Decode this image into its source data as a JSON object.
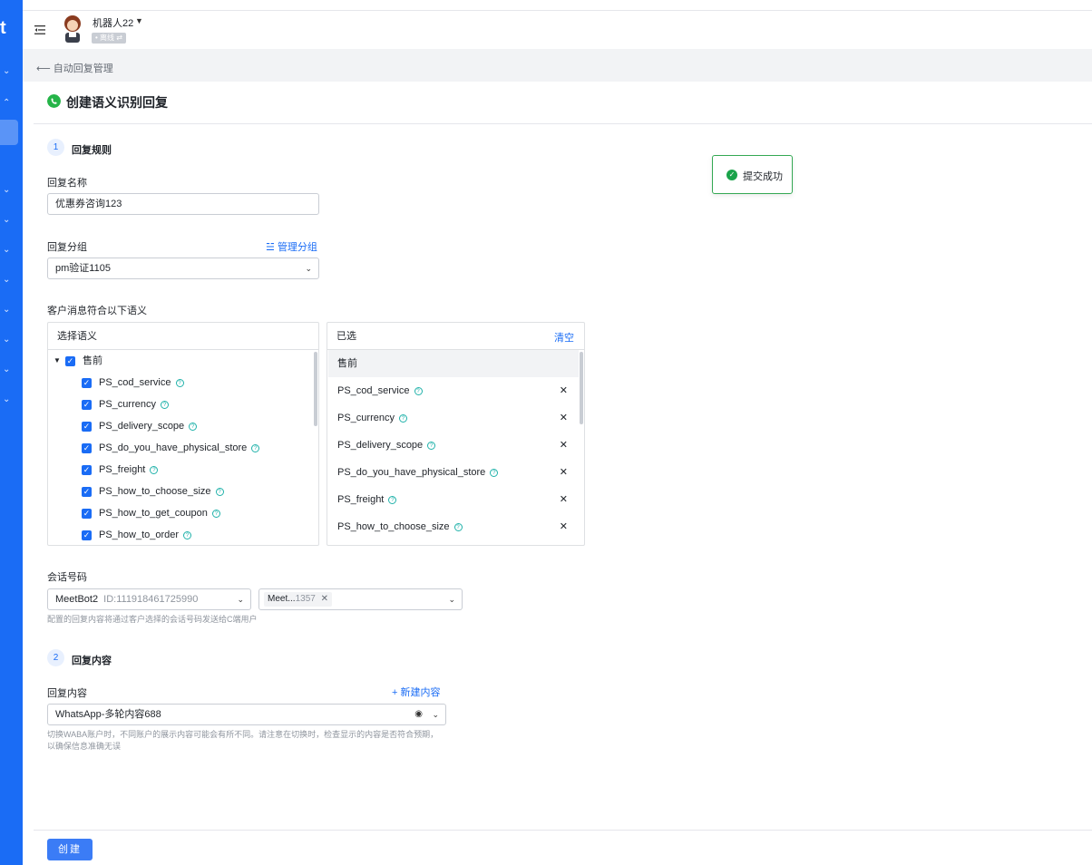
{
  "rail": {
    "logo": "t",
    "chevrons": [
      "⌄",
      "⌃",
      "⌄",
      "⌄",
      "⌄",
      "⌄",
      "⌄",
      "⌄",
      "⌄",
      "⌄"
    ]
  },
  "header": {
    "bot_name": "机器人22",
    "status": "• 离线 ⇄"
  },
  "breadcrumb": {
    "back": "自动回复管理"
  },
  "page": {
    "title": "创建语义识别回复"
  },
  "step1": {
    "num": "1",
    "label": "回复规则"
  },
  "reply_name": {
    "label": "回复名称",
    "value": "优惠券咨询123"
  },
  "reply_group": {
    "label": "回复分组",
    "manage": "管理分组",
    "value": "pm验证1105"
  },
  "semantics": {
    "label": "客户消息符合以下语义",
    "select_title": "选择语义",
    "group": "售前",
    "items": [
      "PS_cod_service",
      "PS_currency",
      "PS_delivery_scope",
      "PS_do_you_have_physical_store",
      "PS_freight",
      "PS_how_to_choose_size",
      "PS_how_to_get_coupon",
      "PS_how_to_order"
    ],
    "selected_title": "已选",
    "clear": "清空",
    "selected_group": "售前",
    "selected_items": [
      "PS_cod_service",
      "PS_currency",
      "PS_delivery_scope",
      "PS_do_you_have_physical_store",
      "PS_freight",
      "PS_how_to_choose_size"
    ]
  },
  "session": {
    "label": "会话号码",
    "bot": "MeetBot2",
    "bot_id": "ID:111918461725990",
    "tag_name": "Meet...",
    "tag_num": "1357",
    "hint": "配置的回复内容将通过客户选择的会话号码发送给C端用户"
  },
  "step2": {
    "num": "2",
    "label": "回复内容"
  },
  "reply_content": {
    "label": "回复内容",
    "new": "新建内容",
    "value": "WhatsApp-多轮内容688",
    "hint1": "切换WABA账户时，不同账户的展示内容可能会有所不同。请注意在切换时，检查显示的内容是否符合预期，",
    "hint2": "以确保信息准确无误"
  },
  "toast": {
    "text": "提交成功"
  },
  "footer": {
    "create": "创建"
  },
  "colors": {
    "primary": "#1a6cf5",
    "success": "#1aa34a",
    "whatsapp": "#25b448"
  }
}
